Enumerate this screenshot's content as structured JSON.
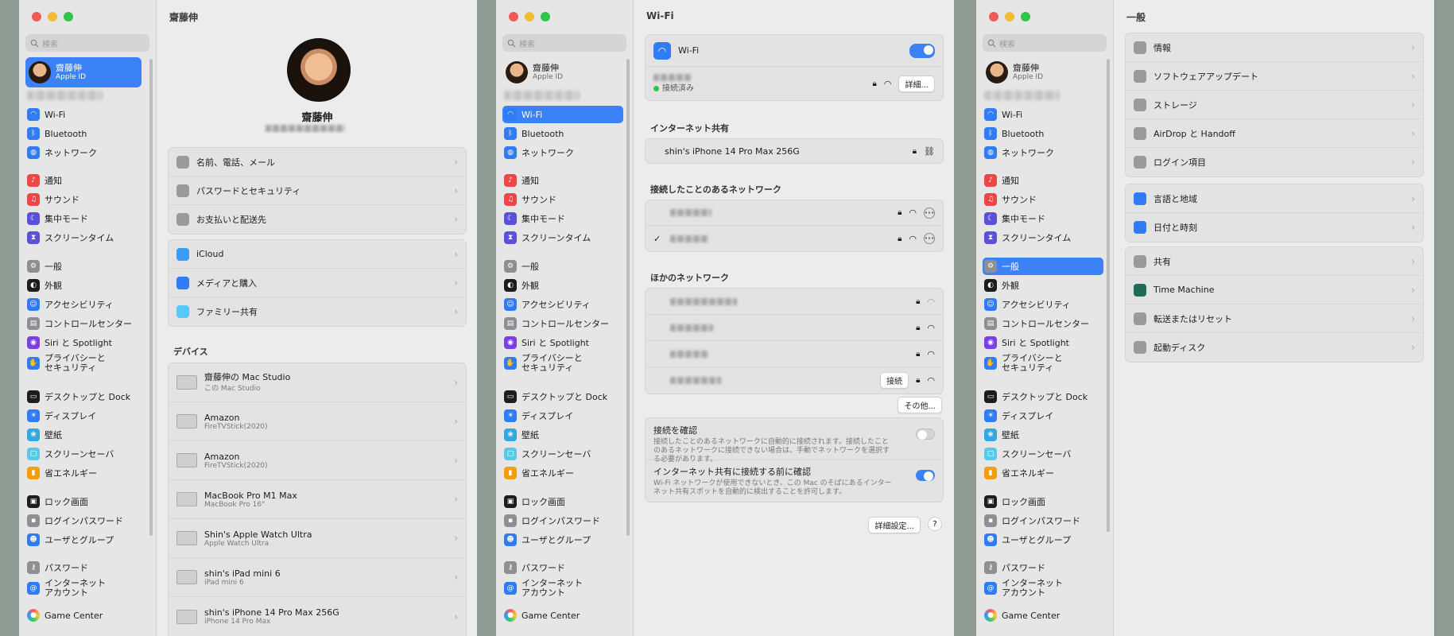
{
  "sidebar": {
    "search_placeholder": "検索",
    "account": {
      "name": "齋藤伸",
      "sub": "Apple ID"
    },
    "items": [
      {
        "key": "wifi",
        "label": "Wi-Fi",
        "icon": "wifi-icon",
        "color": "#2f7cf6"
      },
      {
        "key": "bluetooth",
        "label": "Bluetooth",
        "icon": "bluetooth-icon",
        "color": "#2f7cf6"
      },
      {
        "key": "network",
        "label": "ネットワーク",
        "icon": "globe-icon",
        "color": "#2f7cf6"
      },
      {
        "key": "notifications",
        "label": "通知",
        "icon": "bell-icon",
        "color": "#ee4646"
      },
      {
        "key": "sound",
        "label": "サウンド",
        "icon": "speaker-icon",
        "color": "#ee4646"
      },
      {
        "key": "focus",
        "label": "集中モード",
        "icon": "moon-icon",
        "color": "#5b51d8"
      },
      {
        "key": "screentime",
        "label": "スクリーンタイム",
        "icon": "hourglass-icon",
        "color": "#5b51d8"
      },
      {
        "key": "general",
        "label": "一般",
        "icon": "gear-icon",
        "color": "#8e8e93"
      },
      {
        "key": "appearance",
        "label": "外観",
        "icon": "appearance-icon",
        "color": "#1d1d1f"
      },
      {
        "key": "accessibility",
        "label": "アクセシビリティ",
        "icon": "accessibility-icon",
        "color": "#2f7cf6"
      },
      {
        "key": "controlcenter",
        "label": "コントロールセンター",
        "icon": "control-center-icon",
        "color": "#8e8e93"
      },
      {
        "key": "siri",
        "label": "Siri と Spotlight",
        "icon": "siri-icon",
        "color": "#7b3fe4"
      },
      {
        "key": "privacy",
        "label": "プライバシーと\nセキュリティ",
        "icon": "hand-icon",
        "color": "#2f7cf6"
      },
      {
        "key": "desktop",
        "label": "デスクトップと Dock",
        "icon": "dock-icon",
        "color": "#1d1d1f"
      },
      {
        "key": "displays",
        "label": "ディスプレイ",
        "icon": "sun-icon",
        "color": "#2f7cf6"
      },
      {
        "key": "wallpaper",
        "label": "壁紙",
        "icon": "wallpaper-icon",
        "color": "#30a8e0"
      },
      {
        "key": "screensaver",
        "label": "スクリーンセーバ",
        "icon": "screensaver-icon",
        "color": "#5ac8e8"
      },
      {
        "key": "energy",
        "label": "省エネルギー",
        "icon": "battery-icon",
        "color": "#f59e0b"
      },
      {
        "key": "lockscreen",
        "label": "ロック画面",
        "icon": "lock-screen-icon",
        "color": "#1d1d1f"
      },
      {
        "key": "loginpw",
        "label": "ログインパスワード",
        "icon": "lock-icon",
        "color": "#8e8e93"
      },
      {
        "key": "users",
        "label": "ユーザとグループ",
        "icon": "users-icon",
        "color": "#2f7cf6"
      },
      {
        "key": "passwords",
        "label": "パスワード",
        "icon": "key-icon",
        "color": "#8e8e93"
      },
      {
        "key": "internetaccounts",
        "label": "インターネット\nアカウント",
        "icon": "at-icon",
        "color": "#2f7cf6"
      },
      {
        "key": "gamecenter",
        "label": "Game Center",
        "icon": "game-center-icon",
        "color": "#e0e0e0"
      }
    ]
  },
  "win1": {
    "title": "齋藤伸",
    "profile_name": "齋藤伸",
    "group1": [
      {
        "label": "名前、電話、メール",
        "icon": "contact-icon"
      },
      {
        "label": "パスワードとセキュリティ",
        "icon": "lock-icon"
      },
      {
        "label": "お支払いと配送先",
        "icon": "card-icon"
      }
    ],
    "group2": [
      {
        "label": "iCloud",
        "icon": "cloud-icon"
      },
      {
        "label": "メディアと購入",
        "icon": "app-store-icon"
      },
      {
        "label": "ファミリー共有",
        "icon": "family-icon"
      }
    ],
    "devices_header": "デバイス",
    "devices": [
      {
        "name": "齋藤伸の Mac Studio",
        "sub": "この Mac Studio"
      },
      {
        "name": "Amazon",
        "sub": "FireTVStick(2020)"
      },
      {
        "name": "Amazon",
        "sub": "FireTVStick(2020)"
      },
      {
        "name": "MacBook Pro M1 Max",
        "sub": "MacBook Pro 16\""
      },
      {
        "name": "Shin's Apple Watch Ultra",
        "sub": "Apple Watch Ultra"
      },
      {
        "name": "shin's iPad mini 6",
        "sub": "iPad mini 6"
      },
      {
        "name": "shin's iPhone 14 Pro Max 256G",
        "sub": "iPhone 14 Pro Max"
      }
    ]
  },
  "win2": {
    "title": "Wi-Fi",
    "wifi_label": "Wi-Fi",
    "connected_status": "接続済み",
    "details_button": "詳細...",
    "hotspot_header": "インターネット共有",
    "hotspot_name": "shin's iPhone 14 Pro Max 256G",
    "known_header": "接続したことのあるネットワーク",
    "checkmark": "✓",
    "other_header": "ほかのネットワーク",
    "connect_button": "接続",
    "other_button": "その他...",
    "ask_join_title": "接続を確認",
    "ask_join_desc": "接続したことのあるネットワークに自動的に接続されます。接続したことのあるネットワークに接続できない場合は、手動でネットワークを選択する必要があります。",
    "ask_hotspot_title": "インターネット共有に接続する前に確認",
    "ask_hotspot_desc": "Wi-Fi ネットワークが使用できないとき、この Mac のそばにあるインターネット共有スポットを自動的に検出することを許可します。",
    "advanced_button": "詳細設定...",
    "help_button": "?"
  },
  "win3": {
    "title": "一般",
    "group1": [
      {
        "label": "情報",
        "icon": "info-icon"
      },
      {
        "label": "ソフトウェアアップデート",
        "icon": "update-icon"
      },
      {
        "label": "ストレージ",
        "icon": "storage-icon"
      },
      {
        "label": "AirDrop と Handoff",
        "icon": "airdrop-icon"
      },
      {
        "label": "ログイン項目",
        "icon": "list-icon"
      }
    ],
    "group2": [
      {
        "label": "言語と地域",
        "icon": "globe-icon"
      },
      {
        "label": "日付と時刻",
        "icon": "calendar-icon"
      }
    ],
    "group3": [
      {
        "label": "共有",
        "icon": "sharing-icon"
      },
      {
        "label": "Time Machine",
        "icon": "time-machine-icon"
      },
      {
        "label": "転送またはリセット",
        "icon": "reset-icon"
      },
      {
        "label": "起動ディスク",
        "icon": "disk-icon"
      }
    ]
  },
  "chevron": "›",
  "colors": {
    "accent": "#3b82f6",
    "sidebar_bg": "#e6e6e6",
    "card_bg": "#e3e3e3"
  }
}
